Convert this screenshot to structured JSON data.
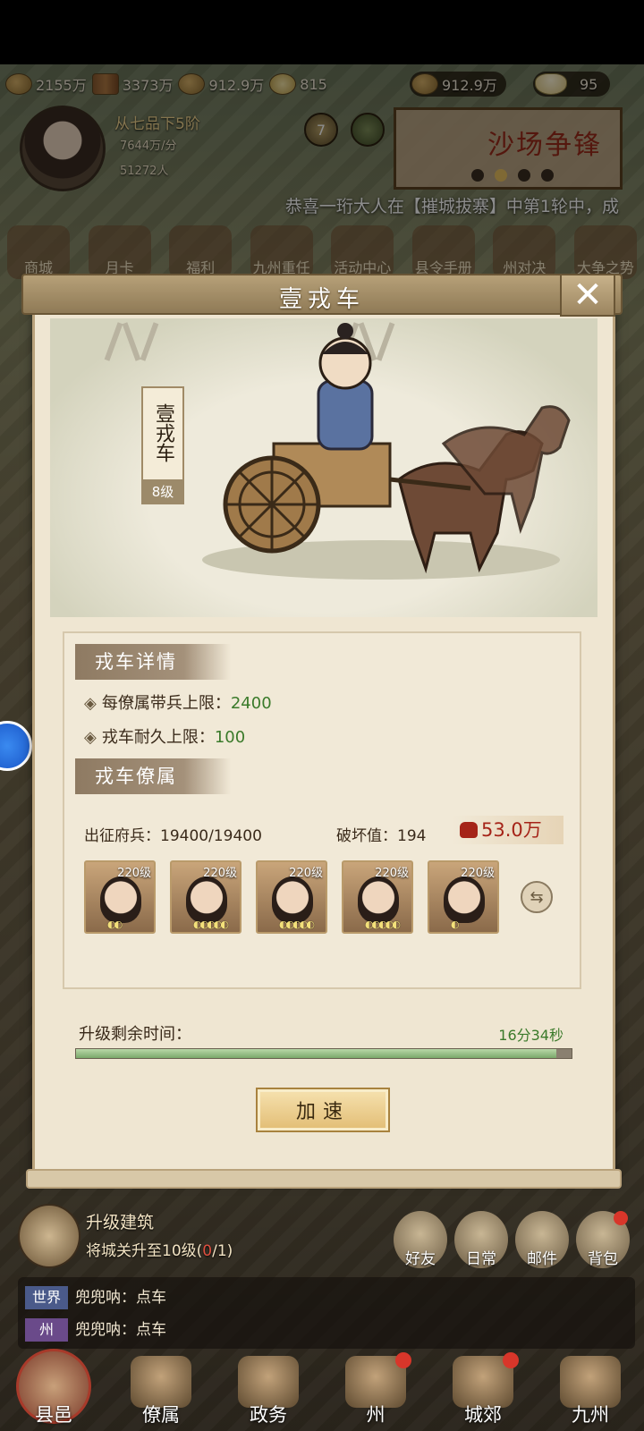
{
  "resources": {
    "r1": "2155万",
    "r2": "3373万",
    "r3": "912.9万",
    "r4": "815",
    "gold_highlight": "912.9万",
    "ingot": "95"
  },
  "player": {
    "rank": "从七品下5阶",
    "income": "7644万/分",
    "population": "51272人",
    "badge_level": "7"
  },
  "banner": {
    "title": "沙场争锋"
  },
  "marquee": "恭喜一珩大人在【摧城拔寨】中第1轮中，成",
  "functions": [
    "商城",
    "月卡",
    "福利",
    "九州重任",
    "活动中心",
    "县令手册",
    "州对决",
    "大争之势"
  ],
  "dialog": {
    "title": "壹戎车",
    "close_glyph": "✕",
    "unit_name": "壹戎车",
    "unit_level": "8级",
    "details_heading": "戎车详情",
    "detail1_label": "每僚属带兵上限：",
    "detail1_value": "2400",
    "detail2_label": "戎车耐久上限：",
    "detail2_value": "100",
    "officers_heading": "戎车僚属",
    "soldiers": "出征府兵：19400/19400",
    "destroy": "破坏值：194",
    "power": "53.0万",
    "officers": [
      {
        "level": "220级",
        "stars": "◐◐"
      },
      {
        "level": "220级",
        "stars": "◐◐◐◐◐"
      },
      {
        "level": "220级",
        "stars": "◐◐◐◐◐"
      },
      {
        "level": "220级",
        "stars": "◐◐◐◐◐"
      },
      {
        "level": "220级",
        "stars": "◐"
      }
    ],
    "timer_label": "升级剩余时间：",
    "timer_value": "16分34秒",
    "progress_fraction": 0.97,
    "speed_button": "加速"
  },
  "quest": {
    "title": "升级建筑",
    "desc_prefix": "将城关升至10级(",
    "desc_progress": "0",
    "desc_suffix": "/1)"
  },
  "side_buttons": [
    "好友",
    "日常",
    "邮件",
    "背包"
  ],
  "chat": [
    {
      "channel": "世界",
      "text": "兜兜呐：点车"
    },
    {
      "channel": "州",
      "text": "兜兜呐：点车"
    }
  ],
  "bottom_nav": [
    "县邑",
    "僚属",
    "政务",
    "州",
    "城郊",
    "九州"
  ],
  "colors": {
    "accent_green": "#3a7a2a",
    "power_red": "#a52418",
    "notify_red": "#d8362a"
  }
}
